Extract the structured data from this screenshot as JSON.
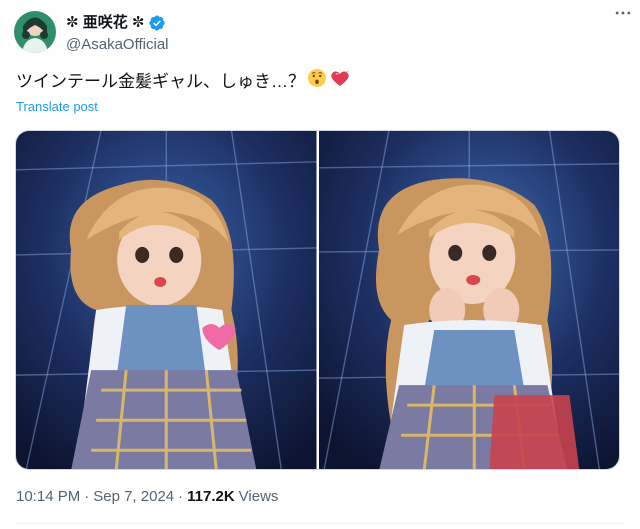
{
  "author": {
    "display_name": "✼ 亜咲花 ✼",
    "handle": "@AsakaOfficial",
    "verified_icon": "verified-badge-icon",
    "avatar_icon": "avatar"
  },
  "post": {
    "text": "ツインテール金髪ギャル、しゅき…？",
    "emojis": [
      "hushed-face",
      "heart-with-sparkle"
    ],
    "translate_label": "Translate post"
  },
  "meta": {
    "time": "10:14 PM",
    "sep1": "·",
    "date": "Sep 7, 2024",
    "sep2": "·",
    "views_count": "117.2K",
    "views_label": "Views"
  },
  "colors": {
    "accent": "#1d9bf0",
    "text": "#0f1419",
    "secondary": "#536471"
  },
  "icons": {
    "more": "more-horizontal-icon"
  }
}
